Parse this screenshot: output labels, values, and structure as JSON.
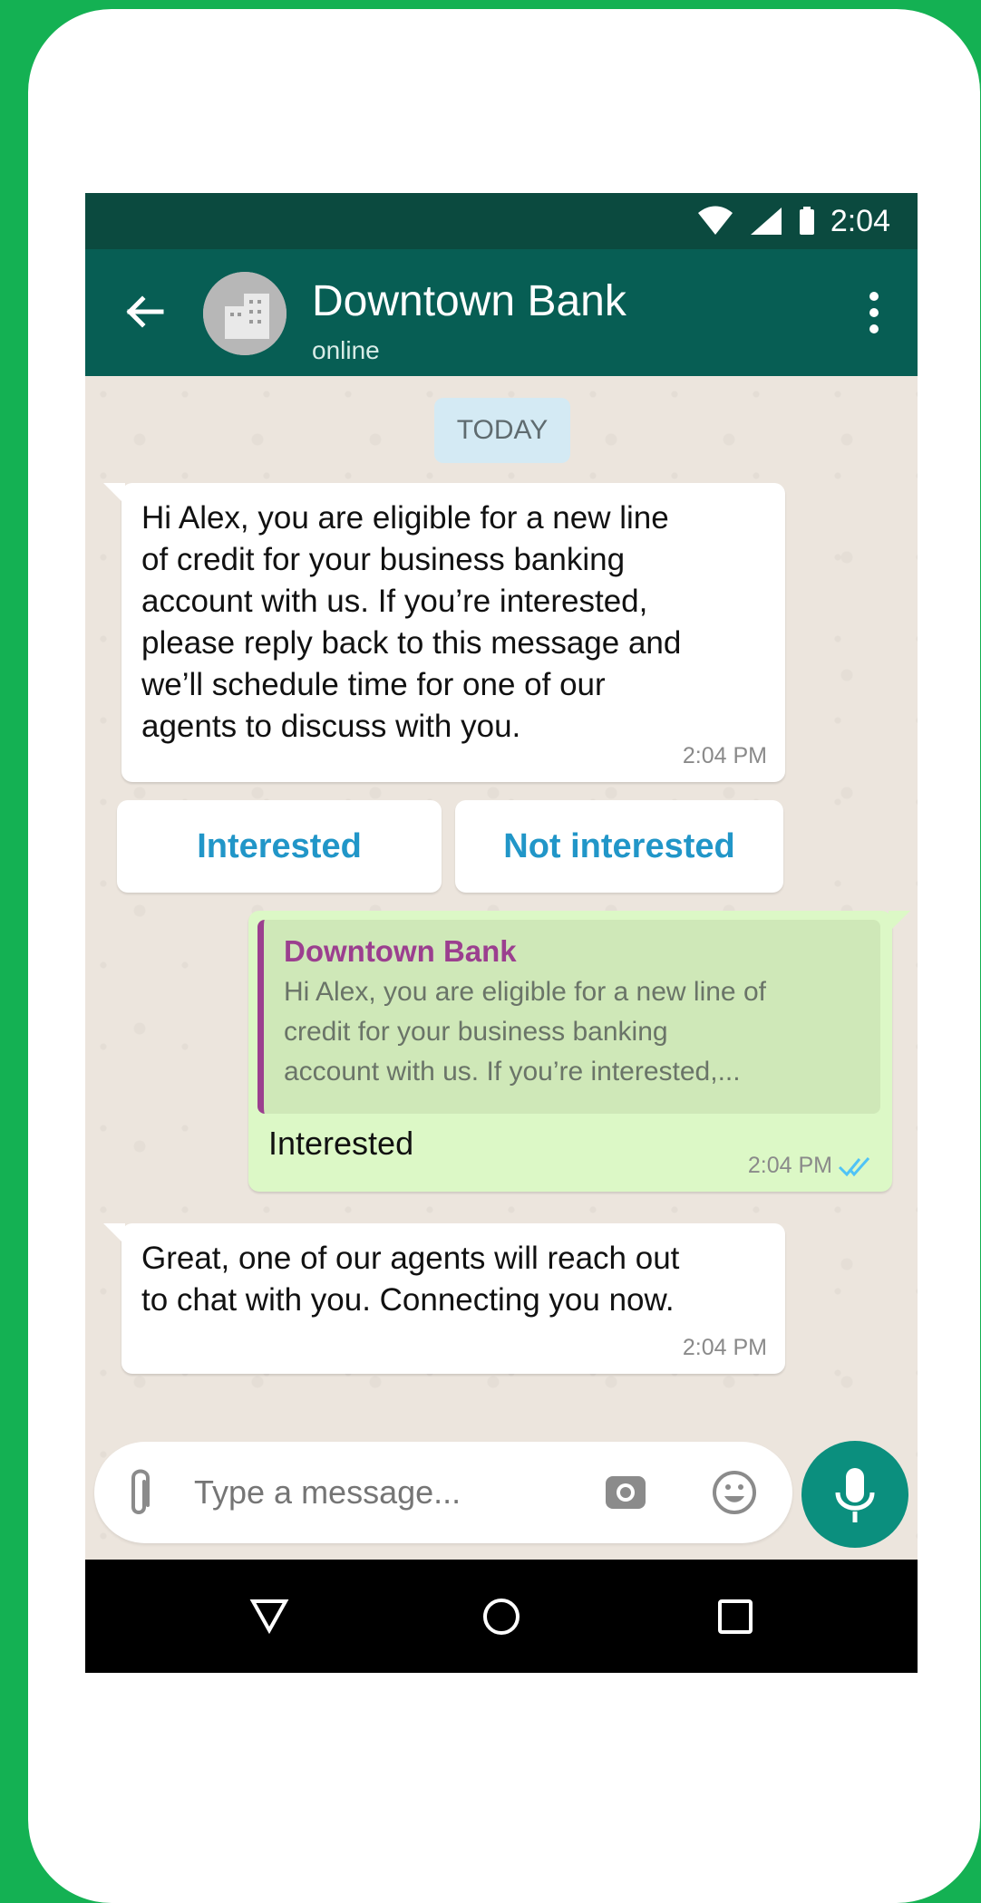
{
  "status_bar": {
    "time": "2:04"
  },
  "header": {
    "title": "Downtown Bank",
    "subtitle": "online"
  },
  "chat": {
    "date_chip": "TODAY",
    "messages": [
      {
        "lines": [
          "Hi Alex, you are eligible for a new line",
          "of credit for your business banking",
          "account with us. If you’re interested,",
          "please reply back to this message and",
          "we’ll schedule time for one of our",
          "agents to discuss with you."
        ],
        "time": "2:04 PM"
      }
    ],
    "quick_replies": [
      "Interested",
      "Not interested"
    ],
    "reply": {
      "quote_author": "Downtown Bank",
      "quote_lines": [
        "Hi Alex, you are eligible for a new line of",
        "credit for your business banking",
        "account with us. If you’re interested,..."
      ],
      "text": "Interested",
      "time": "2:04 PM"
    },
    "followup": {
      "lines": [
        "Great, one of our agents will reach out",
        "to chat with you. Connecting you now."
      ],
      "time": "2:04 PM"
    }
  },
  "composer": {
    "placeholder": "Type a message..."
  },
  "icons": {
    "status": [
      "wifi-icon",
      "signal-icon",
      "battery-icon"
    ],
    "header": [
      "back-arrow-icon",
      "bank-avatar-icon",
      "more-vert-icon"
    ],
    "composer": [
      "paperclip-icon",
      "camera-icon",
      "emoji-icon",
      "mic-icon"
    ],
    "nav": [
      "back-triangle-icon",
      "home-circle-icon",
      "recents-square-icon"
    ]
  },
  "colors": {
    "background": "#14b153",
    "status_bar": "#0b4a3f",
    "app_bar": "#075e54",
    "incoming_bubble": "#ffffff",
    "outgoing_bubble": "#dcf8c6",
    "accent_blue": "#2196c8",
    "quote_author": "#9b3f8f",
    "fab": "#0b8f7e"
  }
}
